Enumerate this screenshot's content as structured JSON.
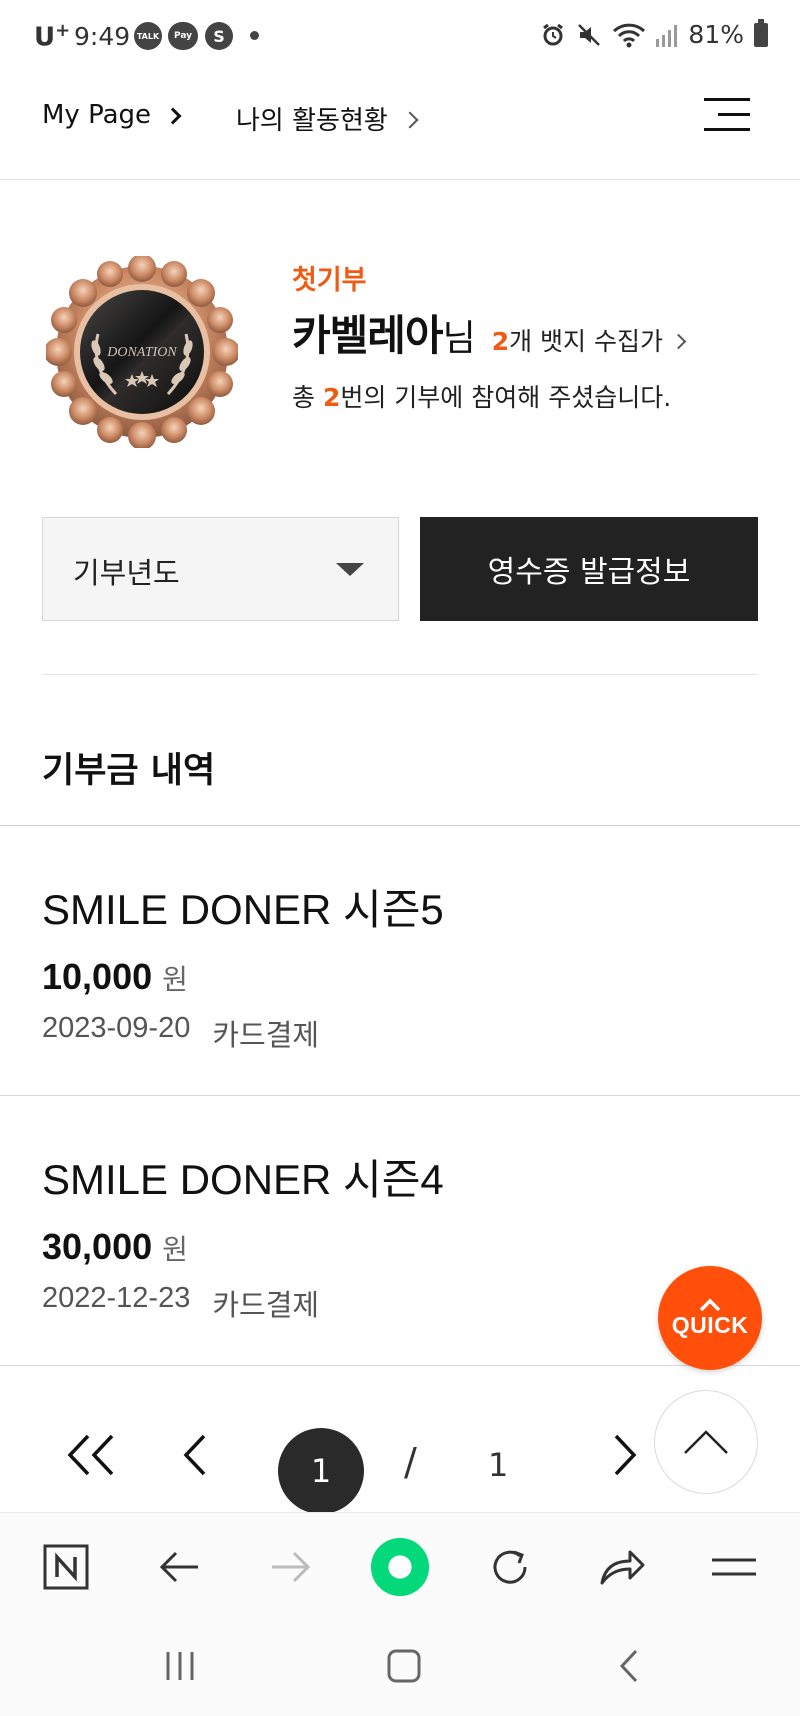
{
  "status_bar": {
    "carrier": "U",
    "carrier_sup": "+",
    "time": "9:49",
    "apps": [
      "TALK",
      "Pay",
      "S"
    ],
    "battery": "81%"
  },
  "header": {
    "crumb_1": "My Page",
    "crumb_2": "나의 활동현황"
  },
  "profile": {
    "badge_text": "DONATION",
    "level": "첫기부",
    "name": "카벨레아",
    "honorific": "님",
    "badge_count": "2",
    "badge_count_suffix": "개 뱃지 수집가",
    "summary_prefix": "총 ",
    "summary_count": "2",
    "summary_suffix": "번의 기부에 참여해 주셨습니다."
  },
  "controls": {
    "year_select": "기부년도",
    "receipt_button": "영수증 발급정보"
  },
  "section_title": "기부금 내역",
  "donations": [
    {
      "title": "SMILE DONER 시즌5",
      "amount": "10,000",
      "unit": "원",
      "date": "2023-09-20",
      "method": "카드결제"
    },
    {
      "title": "SMILE DONER 시즌4",
      "amount": "30,000",
      "unit": "원",
      "date": "2022-12-23",
      "method": "카드결제"
    }
  ],
  "pagination": {
    "current": "1",
    "separator": "/",
    "total": "1"
  },
  "quick_button": "QUICK",
  "colors": {
    "accent": "#f05a12",
    "quick": "#ff4f0a",
    "dark_button": "#222222",
    "naver_green": "#03d87a"
  },
  "toolbar_icons": [
    "naver-n-icon",
    "back-arrow-icon",
    "forward-arrow-icon",
    "green-dot-icon",
    "refresh-icon",
    "share-icon",
    "menu-icon"
  ],
  "system_nav_icons": [
    "recent-apps-icon",
    "home-icon",
    "back-icon"
  ]
}
